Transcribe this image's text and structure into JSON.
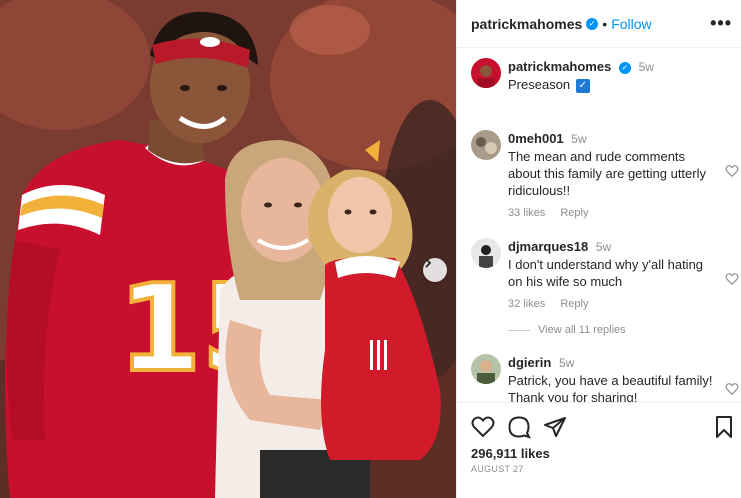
{
  "header": {
    "username": "patrickmahomes",
    "separator": "•",
    "follow_label": "Follow",
    "more_label": "•••"
  },
  "caption": {
    "username": "patrickmahomes",
    "time": "5w",
    "text": "Preseason",
    "emoji": "✓"
  },
  "comments": [
    {
      "username": "0meh001",
      "time": "5w",
      "text": "The mean and rude comments about this family are getting utterly ridiculous!!",
      "likes": "33 likes",
      "reply_label": "Reply"
    },
    {
      "username": "djmarques18",
      "time": "5w",
      "text": "I don't understand why y'all hating on his wife so much",
      "likes": "32 likes",
      "reply_label": "Reply",
      "view_replies": "View all 11 replies"
    },
    {
      "username": "dgierin",
      "time": "5w",
      "text": "Patrick, you have a beautiful family! Thank you for sharing!"
    }
  ],
  "actions": {
    "likes_count": "296,911 likes",
    "date": "AUGUST 27"
  },
  "photo": {
    "jersey_number": "15"
  },
  "colors": {
    "accent": "#0095f6",
    "chiefs_red": "#c8102e",
    "gold": "#f2b13a"
  }
}
